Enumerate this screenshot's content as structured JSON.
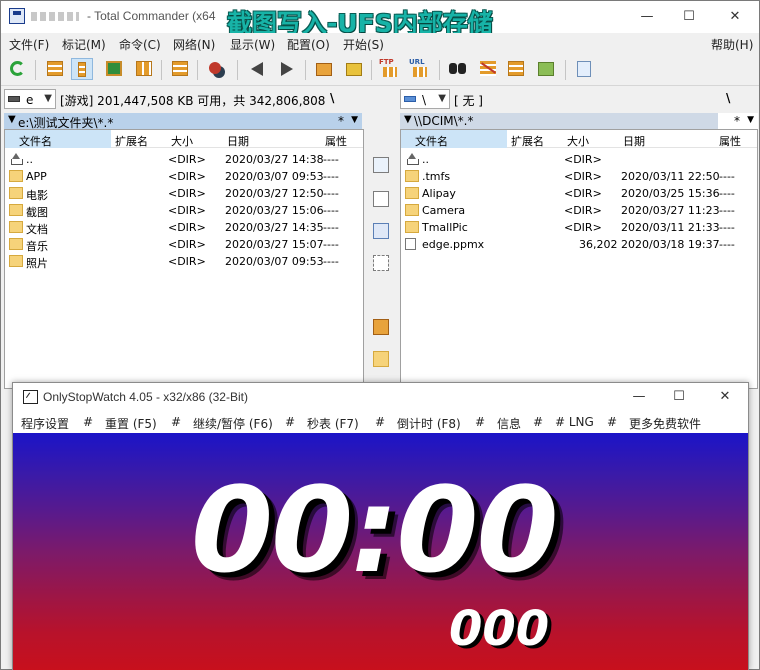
{
  "tc": {
    "title": "- Total Commander (x64",
    "overlay_caption": "截图写入-UFS内部存储",
    "window_buttons": {
      "minimize": "—",
      "maximize": "☐",
      "close": "✕"
    },
    "menu": [
      "文件(F)",
      "标记(M)",
      "命令(C)",
      "网络(N)",
      "显示(W)",
      "配置(O)",
      "开始(S)"
    ],
    "help": "帮助(H)",
    "toolbar_icons": [
      "refresh-icon",
      "brief-view-icon",
      "full-view-icon",
      "thumbnail-view-icon",
      "tree-view-icon",
      "invert-selection-icon",
      "compare-icon",
      "back-icon",
      "forward-icon",
      "pack-icon",
      "unpack-icon",
      "ftp-connect-icon",
      "url-ftp-icon",
      "find-icon",
      "rename-multi-icon",
      "sync-dirs-icon",
      "copy-names-icon",
      "notepad-icon"
    ],
    "toolbar_labels": {
      "ftp": "FTP",
      "url": "URL"
    },
    "left": {
      "drive": "e",
      "drive_info": "[游戏]  201,447,508 KB 可用，共 342,806,808",
      "backslash": "\\",
      "path": "e:\\测试文件夹\\*.*",
      "star": "*",
      "columns": {
        "name": "文件名",
        "ext": "扩展名",
        "size": "大小",
        "date": "日期",
        "attr": "属性"
      },
      "rows": [
        {
          "name": "..",
          "ext": "",
          "size": "<DIR>",
          "date": "2020/03/27 14:38",
          "attr": "----",
          "type": "up"
        },
        {
          "name": "APP",
          "ext": "",
          "size": "<DIR>",
          "date": "2020/03/07 09:53",
          "attr": "----",
          "type": "dir"
        },
        {
          "name": "电影",
          "ext": "",
          "size": "<DIR>",
          "date": "2020/03/27 12:50",
          "attr": "----",
          "type": "dir"
        },
        {
          "name": "截图",
          "ext": "",
          "size": "<DIR>",
          "date": "2020/03/27 15:06",
          "attr": "----",
          "type": "dir"
        },
        {
          "name": "文档",
          "ext": "",
          "size": "<DIR>",
          "date": "2020/03/27 14:35",
          "attr": "----",
          "type": "dir"
        },
        {
          "name": "音乐",
          "ext": "",
          "size": "<DIR>",
          "date": "2020/03/27 15:07",
          "attr": "----",
          "type": "dir"
        },
        {
          "name": "照片",
          "ext": "",
          "size": "<DIR>",
          "date": "2020/03/07 09:53",
          "attr": "----",
          "type": "dir"
        }
      ]
    },
    "right": {
      "drive": "\\",
      "drive_info": "[ 无 ]",
      "backslash": "\\",
      "path": "\\\\DCIM\\*.*",
      "star": "*",
      "columns": {
        "name": "文件名",
        "ext": "扩展名",
        "size": "大小",
        "date": "日期",
        "attr": "属性"
      },
      "rows": [
        {
          "name": "..",
          "ext": "",
          "size": "<DIR>",
          "date": "",
          "attr": "",
          "type": "up"
        },
        {
          "name": ".tmfs",
          "ext": "",
          "size": "<DIR>",
          "date": "2020/03/11 22:50",
          "attr": "----",
          "type": "dir"
        },
        {
          "name": "Alipay",
          "ext": "",
          "size": "<DIR>",
          "date": "2020/03/25 15:36",
          "attr": "----",
          "type": "dir"
        },
        {
          "name": "Camera",
          "ext": "",
          "size": "<DIR>",
          "date": "2020/03/27 11:23",
          "attr": "----",
          "type": "dir"
        },
        {
          "name": "TmallPic",
          "ext": "",
          "size": "<DIR>",
          "date": "2020/03/11 21:33",
          "attr": "----",
          "type": "dir"
        },
        {
          "name": "edge.ppmx",
          "ext": "",
          "size": "36,202",
          "date": "2020/03/18 19:37",
          "attr": "----",
          "type": "file"
        }
      ]
    },
    "middle_buttons": [
      "view-icon",
      "edit-icon",
      "copy-icon",
      "move-icon",
      "pack-icon",
      "new-folder-icon"
    ]
  },
  "stopwatch": {
    "title": "OnlyStopWatch 4.05 - x32/x86 (32-Bit)",
    "window_buttons": {
      "minimize": "—",
      "maximize": "☐",
      "close": "✕"
    },
    "menu": [
      "程序设置",
      "#",
      "重置 (F5)",
      "#",
      "继续/暂停 (F6)",
      "#",
      "秒表 (F7)",
      "#",
      "倒计时 (F8)",
      "#",
      "信息",
      "#",
      "# LNG",
      "#",
      "更多免费软件"
    ],
    "time": "00:00",
    "millis": "000",
    "colors": {
      "top": "#1b14c8",
      "bottom": "#c8101c"
    }
  }
}
